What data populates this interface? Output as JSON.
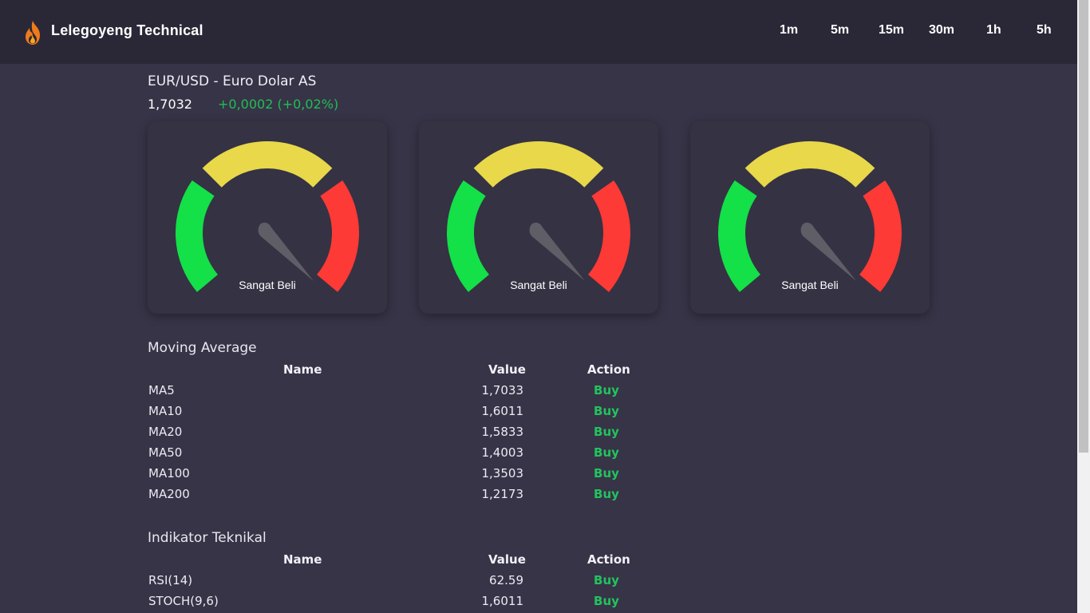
{
  "header": {
    "brand": "Lelegoyeng Technical",
    "logo_icon": "flame-icon",
    "timeframes": [
      "1m",
      "5m",
      "15m",
      "30m",
      "1h",
      "5h"
    ]
  },
  "pair": {
    "title": "EUR/USD - Euro Dolar AS",
    "price": "1,7032",
    "change": "+0,0002 (+0,02%)"
  },
  "gauges": [
    {
      "label": "Sangat Beli"
    },
    {
      "label": "Sangat Beli"
    },
    {
      "label": "Sangat Beli"
    }
  ],
  "colors": {
    "background": "#373447",
    "header": "#2a2837",
    "gauge_green": "#14e048",
    "gauge_yellow": "#e8d84a",
    "gauge_red": "#fd3a35",
    "buy": "#22c35e"
  },
  "moving_average": {
    "title": "Moving Average",
    "columns": [
      "Name",
      "Value",
      "Action"
    ],
    "rows": [
      {
        "name": "MA5",
        "value": "1,7033",
        "action": "Buy"
      },
      {
        "name": "MA10",
        "value": "1,6011",
        "action": "Buy"
      },
      {
        "name": "MA20",
        "value": "1,5833",
        "action": "Buy"
      },
      {
        "name": "MA50",
        "value": "1,4003",
        "action": "Buy"
      },
      {
        "name": "MA100",
        "value": "1,3503",
        "action": "Buy"
      },
      {
        "name": "MA200",
        "value": "1,2173",
        "action": "Buy"
      }
    ]
  },
  "indikator": {
    "title": "Indikator Teknikal",
    "columns": [
      "Name",
      "Value",
      "Action"
    ],
    "rows": [
      {
        "name": "RSI(14)",
        "value": "62.59",
        "action": "Buy"
      },
      {
        "name": "STOCH(9,6)",
        "value": "1,6011",
        "action": "Buy"
      }
    ]
  }
}
